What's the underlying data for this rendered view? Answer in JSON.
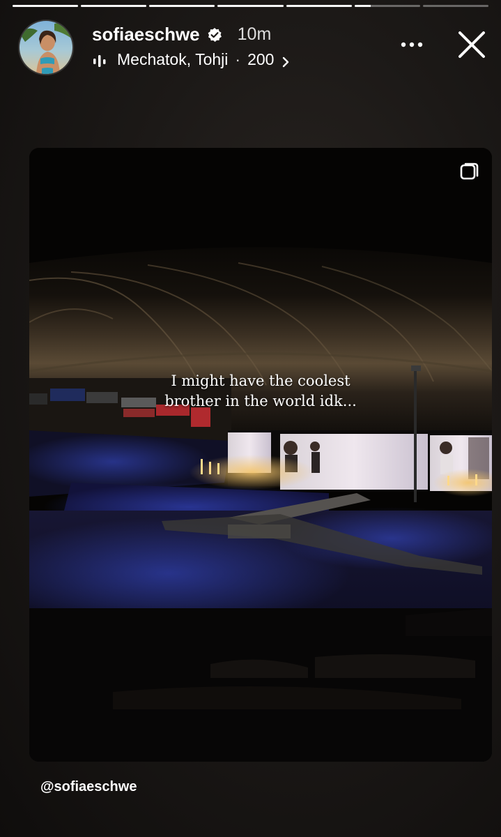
{
  "story": {
    "progress_segments": [
      {
        "fill": 1
      },
      {
        "fill": 1
      },
      {
        "fill": 1
      },
      {
        "fill": 1
      },
      {
        "fill": 1
      },
      {
        "fill": 0.25
      },
      {
        "fill": 0
      }
    ]
  },
  "header": {
    "username": "sofiaeschwe",
    "verified": true,
    "time_ago": "10m",
    "music": {
      "artist": "Mechatok, Tohji",
      "separator": "·",
      "track": "200",
      "icon": "music-bars-icon"
    },
    "more_icon": "more-horizontal-icon",
    "close_icon": "close-icon"
  },
  "post": {
    "caption_lines": [
      "I might have the coolest",
      "brother in the world idk..."
    ],
    "carousel_icon": "carousel-icon"
  },
  "mention": "@sofiaeschwe",
  "colors": {
    "background": "#1c1917",
    "text": "#ffffff",
    "crowd_light": "#3a4fd8",
    "stage_light": "#f3c46a"
  }
}
